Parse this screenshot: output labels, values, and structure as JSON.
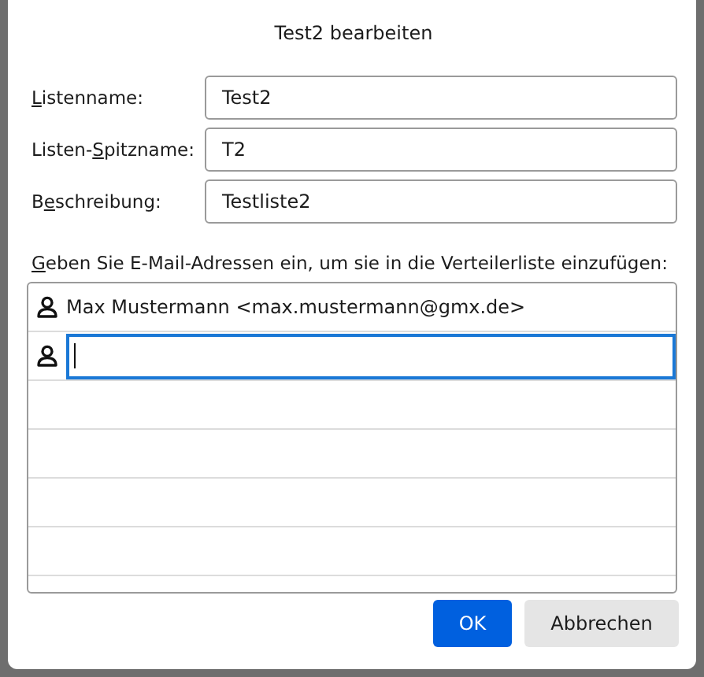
{
  "window": {
    "title": "Test2 bearbeiten"
  },
  "fields": [
    {
      "label": {
        "access_key": "L",
        "after": "istenname:"
      },
      "value": "Test2"
    },
    {
      "label": {
        "before": "Listen-",
        "access_key": "S",
        "after": "pitzname:"
      },
      "value": "T2"
    },
    {
      "label": {
        "before": "B",
        "access_key": "e",
        "after": "schreibung:"
      },
      "value": "Testliste2"
    }
  ],
  "instruction": {
    "access_key": "G",
    "after": "eben Sie E-Mail-Adressen ein, um sie in die Verteilerliste einzufügen:"
  },
  "members": [
    {
      "kind": "entry",
      "text": "Max Mustermann <max.mustermann@gmx.de>"
    },
    {
      "kind": "input",
      "focused": true
    }
  ],
  "buttons": [
    {
      "label": "OK",
      "primary": true
    },
    {
      "label": "Abbrechen",
      "primary": false
    }
  ]
}
